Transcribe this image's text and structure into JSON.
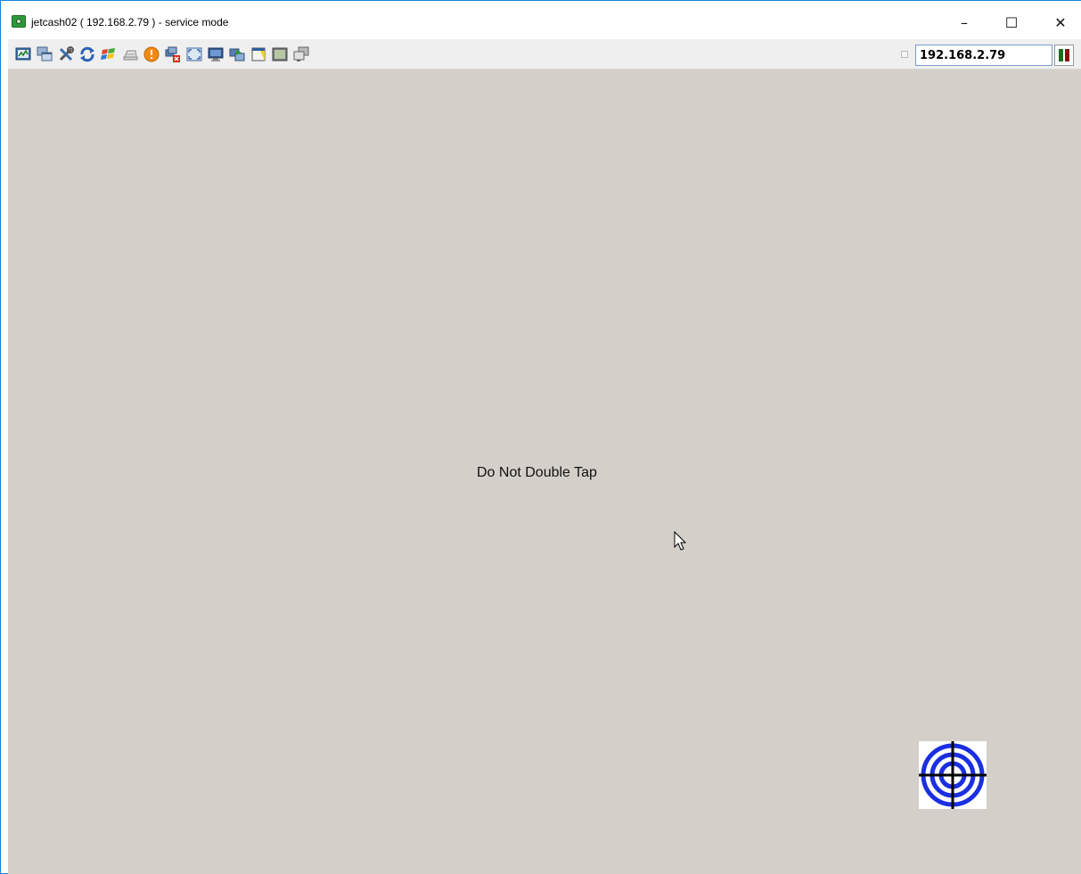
{
  "window": {
    "title": "jetcash02 ( 192.168.2.79 ) - service mode",
    "controls": {
      "minimize": "–",
      "maximize": "☐",
      "close": "✕"
    }
  },
  "toolbar": {
    "icons": [
      "monitor-graph-icon",
      "windows-cascade-icon",
      "tools-icon",
      "refresh-icon",
      "windows-logo-icon",
      "keyboard-icon",
      "alert-icon",
      "disconnect-icon",
      "fullscreen-icon",
      "monitor-icon",
      "transfer-icon",
      "document-icon",
      "screen-frame-icon",
      "multi-window-icon"
    ],
    "host_field": {
      "value": "192.168.2.79"
    }
  },
  "screen": {
    "notice": "Do Not Double Tap",
    "background_color": "#d4d0c9"
  },
  "colors": {
    "accent_border": "#1883d7",
    "target_ring": "#1b2fe0",
    "pause_left": "#1a6e1a",
    "pause_right": "#8a1010"
  }
}
